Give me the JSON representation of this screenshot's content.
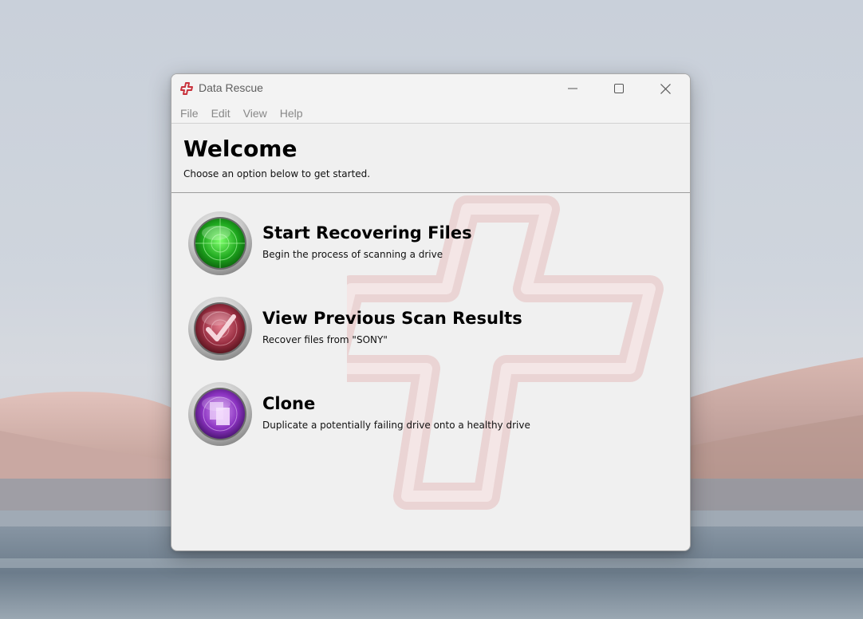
{
  "window": {
    "title": "Data Rescue",
    "app_icon": "data-rescue-cross-icon"
  },
  "titlebar_buttons": {
    "minimize_icon": "minimize-icon",
    "maximize_icon": "maximize-icon",
    "close_icon": "close-icon"
  },
  "menu": {
    "items": [
      {
        "label": "File"
      },
      {
        "label": "Edit"
      },
      {
        "label": "View"
      },
      {
        "label": "Help"
      }
    ]
  },
  "header": {
    "title": "Welcome",
    "subtitle": "Choose an option below to get started."
  },
  "options": [
    {
      "title": "Start Recovering Files",
      "description": "Begin the process of scanning a drive",
      "icon": "radar-scan-icon",
      "color": "#2fb62f"
    },
    {
      "title": "View Previous Scan Results",
      "description": "Recover files from \"SONY\"",
      "icon": "checkmark-radar-icon",
      "color": "#a53a4c"
    },
    {
      "title": "Clone",
      "description": "Duplicate a potentially failing drive onto a healthy drive",
      "icon": "clone-documents-icon",
      "color": "#8a3cc0"
    }
  ],
  "colors": {
    "brand_red": "#c8323c",
    "watermark": "#e8c9c9"
  }
}
